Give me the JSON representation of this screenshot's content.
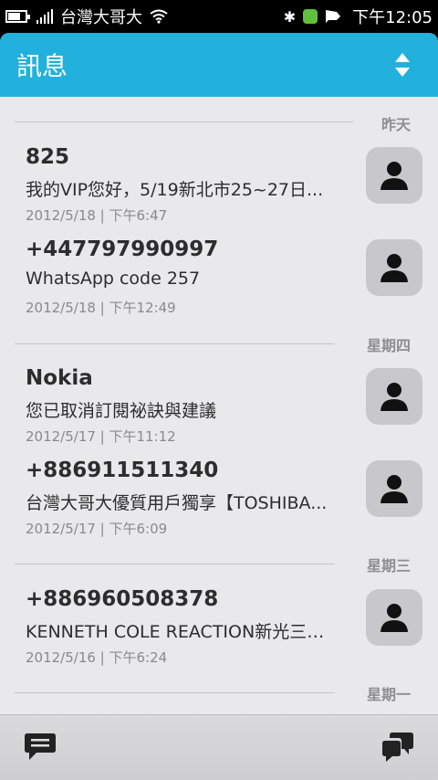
{
  "status_bar": {
    "carrier": "台灣大哥大",
    "time": "下午12:05",
    "bluetooth_glyph": "✱",
    "battery_level_percent": 70,
    "icons": [
      "battery-icon",
      "signal-icon",
      "wifi-icon",
      "bluetooth-icon",
      "app-notification-icon",
      "chat-notification-icon"
    ]
  },
  "header": {
    "title": "訊息",
    "sort_icon": "sort-arrows-icon"
  },
  "colors": {
    "header": "#21b1dc",
    "background": "#e9e9eb",
    "avatar": "#c8c8cc"
  },
  "groups": [
    {
      "label": "昨天",
      "items": [
        {
          "name": "825",
          "preview": "我的VIP您好，5/19新北市25~27日...",
          "time": "2012/5/18 | 下午6:47"
        },
        {
          "name": "+447797990997",
          "preview": "WhatsApp code 257",
          "time": "2012/5/18 | 下午12:49"
        }
      ]
    },
    {
      "label": "星期四",
      "items": [
        {
          "name": "Nokia",
          "preview": "您已取消訂閱祕訣與建議",
          "time": "2012/5/17 | 下午11:12"
        },
        {
          "name": "+886911511340",
          "preview": "台灣大哥大優質用戶獨享【TOSHIBA...",
          "time": "2012/5/17 | 下午6:09"
        }
      ]
    },
    {
      "label": "星期三",
      "items": [
        {
          "name": "+886960508378",
          "preview": "KENNETH COLE REACTION新光三越...",
          "time": "2012/5/16 | 下午6:24"
        }
      ]
    },
    {
      "label": "星期一",
      "items": []
    }
  ],
  "toolbar": {
    "left_icon": "new-message-icon",
    "right_icon": "conversations-icon"
  }
}
